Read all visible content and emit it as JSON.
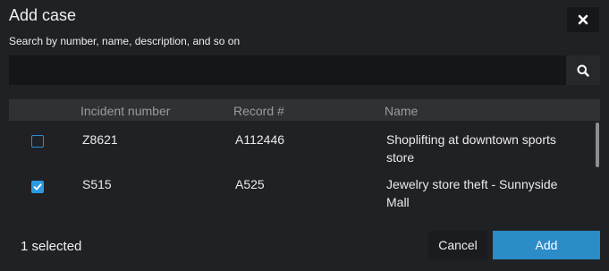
{
  "dialog": {
    "title": "Add case",
    "close_icon": "close-icon"
  },
  "search": {
    "label": "Search by number, name, description, and so on",
    "value": "",
    "placeholder": "",
    "icon": "search-icon"
  },
  "table": {
    "columns": [
      "Incident number",
      "Record #",
      "Name"
    ],
    "rows": [
      {
        "checked": false,
        "incident_number": "Z8621",
        "record": "A112446",
        "name_line1": "Shoplifting at downtown sports",
        "name_line2": "store"
      },
      {
        "checked": true,
        "incident_number": "S515",
        "record": "A525",
        "name_line1": "Jewelry store theft - Sunnyside",
        "name_line2": "Mall"
      }
    ]
  },
  "footer": {
    "selected_text": "1 selected",
    "cancel_label": "Cancel",
    "add_label": "Add"
  },
  "colors": {
    "background": "#202124",
    "accent": "#2b8cc8",
    "checkbox": "#2b9be0"
  }
}
